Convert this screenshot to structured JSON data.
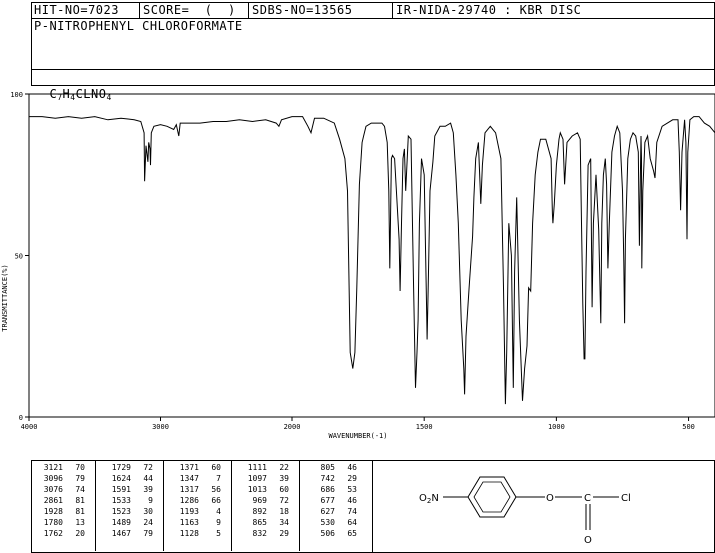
{
  "header": {
    "hit_no": "HIT-NO=7023",
    "score": "SCORE=  (  )",
    "sdbs_no": "SDBS-NO=13565",
    "ir_nida": "IR-NIDA-29740 : KBR DISC",
    "compound_name": "P-NITROPHENYL CHLOROFORMATE",
    "formula_parts": [
      "C",
      "7",
      "H",
      "4",
      "CLNO",
      "4"
    ]
  },
  "chart_data": {
    "type": "line",
    "title": "",
    "xlabel": "WAVENUMBER(-1)",
    "ylabel": "TRANSMITTANCE(%)",
    "xlim": [
      4000,
      400
    ],
    "ylim": [
      0,
      100
    ],
    "x_ticks": [
      "4000",
      "3000",
      "2000",
      "1500",
      "1000",
      "500"
    ],
    "y_ticks": [
      "100",
      "50",
      "0"
    ],
    "series": [
      {
        "name": "",
        "points": [
          [
            4000,
            93
          ],
          [
            3900,
            93
          ],
          [
            3800,
            92.5
          ],
          [
            3700,
            93
          ],
          [
            3600,
            92.5
          ],
          [
            3500,
            93
          ],
          [
            3400,
            92
          ],
          [
            3300,
            92.5
          ],
          [
            3200,
            92
          ],
          [
            3150,
            91.5
          ],
          [
            3125,
            88
          ],
          [
            3121,
            73
          ],
          [
            3110,
            84
          ],
          [
            3096,
            79
          ],
          [
            3090,
            85
          ],
          [
            3080,
            83
          ],
          [
            3076,
            78
          ],
          [
            3070,
            88
          ],
          [
            3050,
            90
          ],
          [
            3000,
            90.5
          ],
          [
            2950,
            90
          ],
          [
            2900,
            89
          ],
          [
            2880,
            90.5
          ],
          [
            2861,
            87
          ],
          [
            2850,
            91
          ],
          [
            2800,
            91
          ],
          [
            2700,
            91
          ],
          [
            2600,
            91.5
          ],
          [
            2500,
            91.5
          ],
          [
            2400,
            92
          ],
          [
            2300,
            91.5
          ],
          [
            2200,
            92
          ],
          [
            2120,
            91
          ],
          [
            2100,
            90
          ],
          [
            2080,
            92
          ],
          [
            2000,
            93
          ],
          [
            1960,
            93
          ],
          [
            1940,
            90
          ],
          [
            1928,
            88
          ],
          [
            1915,
            92.5
          ],
          [
            1880,
            92.5
          ],
          [
            1840,
            91
          ],
          [
            1820,
            86
          ],
          [
            1800,
            80
          ],
          [
            1790,
            70
          ],
          [
            1780,
            20
          ],
          [
            1770,
            15
          ],
          [
            1762,
            20
          ],
          [
            1755,
            40
          ],
          [
            1745,
            72
          ],
          [
            1735,
            85
          ],
          [
            1729,
            87
          ],
          [
            1720,
            90
          ],
          [
            1700,
            91
          ],
          [
            1680,
            91
          ],
          [
            1660,
            91
          ],
          [
            1650,
            90
          ],
          [
            1640,
            85
          ],
          [
            1634,
            70
          ],
          [
            1630,
            46
          ],
          [
            1627,
            63
          ],
          [
            1624,
            80
          ],
          [
            1620,
            81
          ],
          [
            1612,
            80
          ],
          [
            1605,
            70
          ],
          [
            1595,
            55
          ],
          [
            1591,
            39
          ],
          [
            1586,
            60
          ],
          [
            1580,
            80
          ],
          [
            1575,
            83
          ],
          [
            1570,
            70
          ],
          [
            1560,
            87
          ],
          [
            1550,
            86
          ],
          [
            1540,
            40
          ],
          [
            1533,
            9
          ],
          [
            1527,
            20
          ],
          [
            1523,
            30
          ],
          [
            1518,
            60
          ],
          [
            1510,
            80
          ],
          [
            1500,
            75
          ],
          [
            1490,
            30
          ],
          [
            1489,
            24
          ],
          [
            1485,
            40
          ],
          [
            1478,
            70
          ],
          [
            1467,
            79
          ],
          [
            1460,
            87
          ],
          [
            1440,
            90
          ],
          [
            1420,
            90
          ],
          [
            1400,
            91
          ],
          [
            1390,
            88
          ],
          [
            1380,
            75
          ],
          [
            1371,
            60
          ],
          [
            1360,
            30
          ],
          [
            1350,
            15
          ],
          [
            1347,
            7
          ],
          [
            1342,
            25
          ],
          [
            1330,
            40
          ],
          [
            1317,
            56
          ],
          [
            1312,
            68
          ],
          [
            1305,
            80
          ],
          [
            1295,
            85
          ],
          [
            1286,
            66
          ],
          [
            1280,
            78
          ],
          [
            1270,
            88
          ],
          [
            1250,
            90
          ],
          [
            1230,
            88
          ],
          [
            1210,
            80
          ],
          [
            1200,
            40
          ],
          [
            1193,
            4
          ],
          [
            1188,
            20
          ],
          [
            1180,
            60
          ],
          [
            1170,
            50
          ],
          [
            1163,
            9
          ],
          [
            1158,
            45
          ],
          [
            1150,
            68
          ],
          [
            1145,
            50
          ],
          [
            1140,
            30
          ],
          [
            1128,
            5
          ],
          [
            1120,
            15
          ],
          [
            1111,
            22
          ],
          [
            1105,
            40
          ],
          [
            1097,
            39
          ],
          [
            1090,
            60
          ],
          [
            1080,
            75
          ],
          [
            1070,
            82
          ],
          [
            1060,
            86
          ],
          [
            1040,
            86
          ],
          [
            1020,
            80
          ],
          [
            1015,
            63
          ],
          [
            1013,
            60
          ],
          [
            1008,
            66
          ],
          [
            1000,
            78
          ],
          [
            990,
            86
          ],
          [
            985,
            88
          ],
          [
            975,
            86
          ],
          [
            969,
            72
          ],
          [
            960,
            85
          ],
          [
            950,
            86
          ],
          [
            940,
            87
          ],
          [
            920,
            88
          ],
          [
            910,
            86
          ],
          [
            905,
            60
          ],
          [
            900,
            35
          ],
          [
            895,
            18
          ],
          [
            892,
            18
          ],
          [
            888,
            45
          ],
          [
            880,
            78
          ],
          [
            870,
            80
          ],
          [
            865,
            34
          ],
          [
            860,
            60
          ],
          [
            850,
            75
          ],
          [
            840,
            58
          ],
          [
            832,
            29
          ],
          [
            828,
            60
          ],
          [
            822,
            75
          ],
          [
            815,
            80
          ],
          [
            810,
            72
          ],
          [
            805,
            46
          ],
          [
            800,
            60
          ],
          [
            790,
            82
          ],
          [
            780,
            87
          ],
          [
            770,
            90
          ],
          [
            760,
            88
          ],
          [
            750,
            70
          ],
          [
            745,
            48
          ],
          [
            742,
            29
          ],
          [
            739,
            55
          ],
          [
            730,
            80
          ],
          [
            720,
            86
          ],
          [
            710,
            88
          ],
          [
            700,
            87
          ],
          [
            690,
            82
          ],
          [
            686,
            53
          ],
          [
            682,
            75
          ],
          [
            680,
            87
          ],
          [
            678,
            80
          ],
          [
            677,
            46
          ],
          [
            673,
            70
          ],
          [
            665,
            85
          ],
          [
            655,
            87
          ],
          [
            645,
            80
          ],
          [
            632,
            76
          ],
          [
            627,
            74
          ],
          [
            620,
            85
          ],
          [
            600,
            90
          ],
          [
            580,
            91
          ],
          [
            560,
            92
          ],
          [
            540,
            92
          ],
          [
            535,
            82
          ],
          [
            530,
            64
          ],
          [
            525,
            82
          ],
          [
            515,
            92
          ],
          [
            510,
            85
          ],
          [
            506,
            55
          ],
          [
            503,
            82
          ],
          [
            495,
            92
          ],
          [
            480,
            93
          ],
          [
            460,
            93
          ],
          [
            440,
            91
          ],
          [
            420,
            90
          ],
          [
            400,
            88
          ]
        ]
      }
    ]
  },
  "peak_table": {
    "columns": [
      [
        [
          "3121",
          "70"
        ],
        [
          "3096",
          "79"
        ],
        [
          "3076",
          "74"
        ],
        [
          "2861",
          "81"
        ],
        [
          "1928",
          "81"
        ],
        [
          "1780",
          "13"
        ],
        [
          "1762",
          "20"
        ]
      ],
      [
        [
          "1729",
          "72"
        ],
        [
          "1624",
          "44"
        ],
        [
          "1591",
          "39"
        ],
        [
          "1533",
          "9"
        ],
        [
          "1523",
          "30"
        ],
        [
          "1489",
          "24"
        ],
        [
          "1467",
          "79"
        ]
      ],
      [
        [
          "1371",
          "60"
        ],
        [
          "1347",
          "7"
        ],
        [
          "1317",
          "56"
        ],
        [
          "1286",
          "66"
        ],
        [
          "1193",
          "4"
        ],
        [
          "1163",
          "9"
        ],
        [
          "1128",
          "5"
        ]
      ],
      [
        [
          "1111",
          "22"
        ],
        [
          "1097",
          "39"
        ],
        [
          "1013",
          "60"
        ],
        [
          "969",
          "72"
        ],
        [
          "892",
          "18"
        ],
        [
          "865",
          "34"
        ],
        [
          "832",
          "29"
        ]
      ],
      [
        [
          "805",
          "46"
        ],
        [
          "742",
          "29"
        ],
        [
          "686",
          "53"
        ],
        [
          "677",
          "46"
        ],
        [
          "627",
          "74"
        ],
        [
          "530",
          "64"
        ],
        [
          "506",
          "65"
        ]
      ]
    ]
  },
  "structure": {
    "left_group": "O2N",
    "right_group": "O-C-Cl",
    "carbonyl_o": "O"
  }
}
